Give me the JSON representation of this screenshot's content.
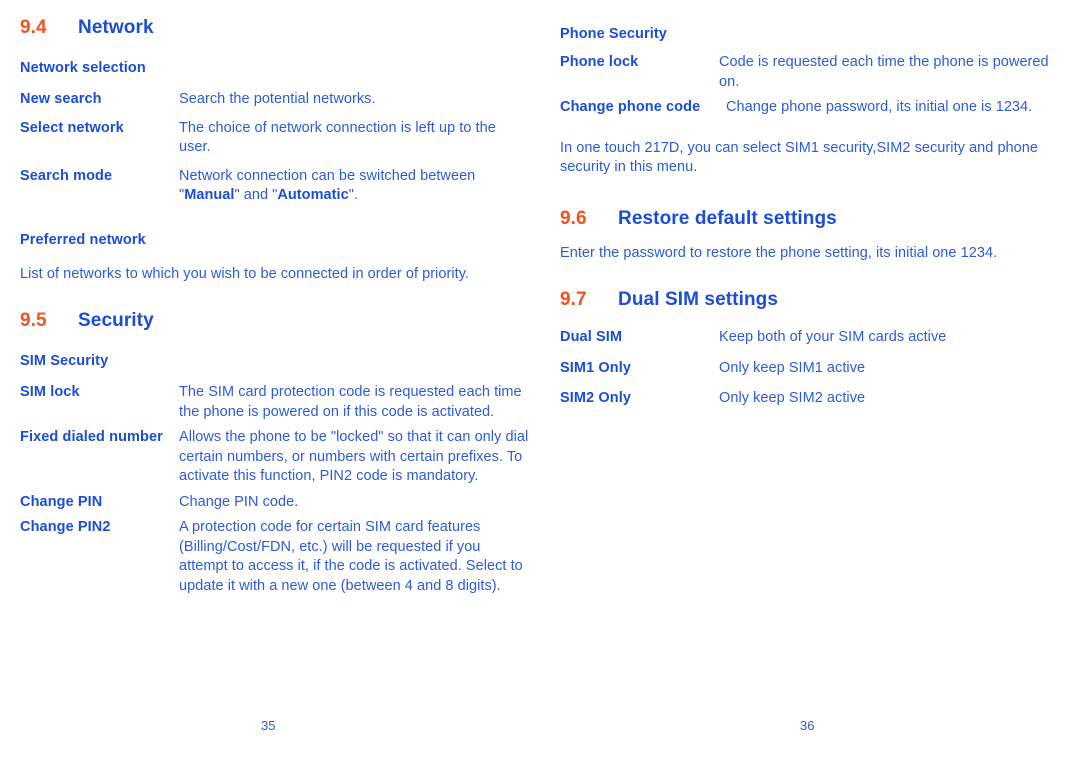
{
  "document": {
    "colors": {
      "heading_number": "#F4511E",
      "heading_title": "#1B4DD8",
      "term": "#1B4DD8",
      "body": "#2B5CD9"
    }
  },
  "left_page": {
    "folio": "35",
    "section_network": {
      "number": "9.4",
      "title": "Network",
      "sub_network_selection": "Network selection",
      "rows": [
        {
          "term": "New search",
          "desc": "Search the potential networks."
        },
        {
          "term": "Select network",
          "desc": "The choice of network connection is left up to the user."
        },
        {
          "term": "Search mode",
          "desc_prefix": "Network connection can be switched between \"",
          "desc_bold1": "Manual",
          "desc_mid": "\" and \"",
          "desc_bold2": "Automatic",
          "desc_suffix": "\"."
        }
      ],
      "sub_preferred_network": "Preferred network",
      "preferred_network_text": "List of networks to which you wish to be connected in order of priority."
    },
    "section_security": {
      "number": "9.5",
      "title": "Security",
      "sub_sim_security": "SIM Security",
      "rows": [
        {
          "term": "SIM lock",
          "desc": "The SIM card protection code is requested each time the phone is powered on if this code is activated."
        },
        {
          "term": "Fixed dialed number",
          "desc": "Allows the phone to be \"locked\" so that it can only dial certain numbers, or numbers with certain prefixes. To activate this function, PIN2 code is mandatory."
        },
        {
          "term": "Change PIN",
          "desc": "Change PIN code."
        },
        {
          "term": "Change PIN2",
          "desc": "A protection code for certain SIM card features (Billing/Cost/FDN, etc.) will be requested if you attempt to access it, if the code is activated. Select to update it with a new one (between 4 and 8 digits)."
        }
      ]
    }
  },
  "right_page": {
    "folio": "36",
    "section_phone_security": {
      "sub_phone_security": "Phone Security",
      "rows": [
        {
          "term": "Phone lock",
          "desc": "Code is requested each time the phone is powered on."
        },
        {
          "term": "Change phone code",
          "desc": "Change phone password, its initial one is 1234."
        }
      ],
      "note": "In one touch 217D, you can select SIM1 security,SIM2 security and phone security in this menu."
    },
    "section_restore": {
      "number": "9.6",
      "title": "Restore default settings",
      "text": "Enter the password to restore the phone setting, its initial one 1234."
    },
    "section_dual_sim": {
      "number": "9.7",
      "title": "Dual SIM settings",
      "rows": [
        {
          "term": "Dual SIM",
          "desc": "Keep both of your SIM cards active"
        },
        {
          "term": "SIM1 Only",
          "desc": "Only keep SIM1 active"
        },
        {
          "term": "SIM2 Only",
          "desc": "Only keep SIM2 active"
        }
      ]
    }
  }
}
